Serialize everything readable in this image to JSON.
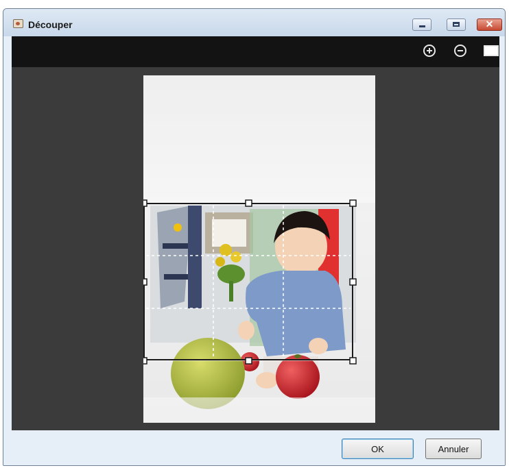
{
  "window": {
    "title": "Découper"
  },
  "title_buttons": {
    "close": "✕"
  },
  "toolbar": {
    "zoom_in_icon": "zoom-in-icon",
    "zoom_out_icon": "zoom-out-icon",
    "fit_icon": "fit-window-icon"
  },
  "footer": {
    "ok_label": "OK",
    "cancel_label": "Annuler"
  },
  "colors": {
    "toolbar": "#131313",
    "canvas": "#3b3b3b",
    "apple_green": "#a8b544",
    "apple_red": "#c8242a",
    "shirt": "#7d9ac8"
  }
}
